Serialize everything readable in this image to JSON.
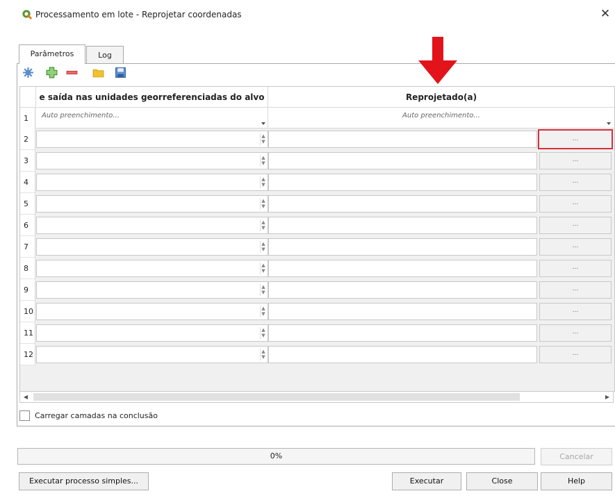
{
  "window": {
    "title": "Processamento em lote - Reprojetar coordenadas",
    "close_symbol": "✕",
    "logo_letter": "Q"
  },
  "tabs": [
    {
      "label": "Parâmetros",
      "active": true
    },
    {
      "label": "Log",
      "active": false
    }
  ],
  "toolbar": {
    "icons": [
      "autofill-icon",
      "add-row-icon",
      "remove-row-icon",
      "open-folder-icon",
      "save-icon"
    ]
  },
  "table": {
    "headers": [
      "e saída nas unidades georreferenciadas do alvo",
      "Reprojetado(a)"
    ],
    "autofill_row": {
      "number": "1",
      "col1": "Auto preenchimento...",
      "col2": "Auto preenchimento..."
    },
    "rows": [
      {
        "number": "2",
        "browse": "..."
      },
      {
        "number": "3",
        "browse": "..."
      },
      {
        "number": "4",
        "browse": "..."
      },
      {
        "number": "5",
        "browse": "..."
      },
      {
        "number": "6",
        "browse": "..."
      },
      {
        "number": "7",
        "browse": "..."
      },
      {
        "number": "8",
        "browse": "..."
      },
      {
        "number": "9",
        "browse": "..."
      },
      {
        "number": "10",
        "browse": "..."
      },
      {
        "number": "11",
        "browse": "..."
      },
      {
        "number": "12",
        "browse": "..."
      }
    ],
    "highlighted_row": "2"
  },
  "load_layers_checkbox": {
    "label": "Carregar camadas na conclusão",
    "checked": false
  },
  "progress": {
    "text": "0%",
    "value": 0
  },
  "buttons": {
    "cancel": "Cancelar",
    "run_single": "Executar processo simples...",
    "run": "Executar",
    "close": "Close",
    "help": "Help"
  },
  "colors": {
    "annotation_red": "#e3131b",
    "highlight_border": "#d42f3b",
    "qgis_green": "#589632"
  }
}
